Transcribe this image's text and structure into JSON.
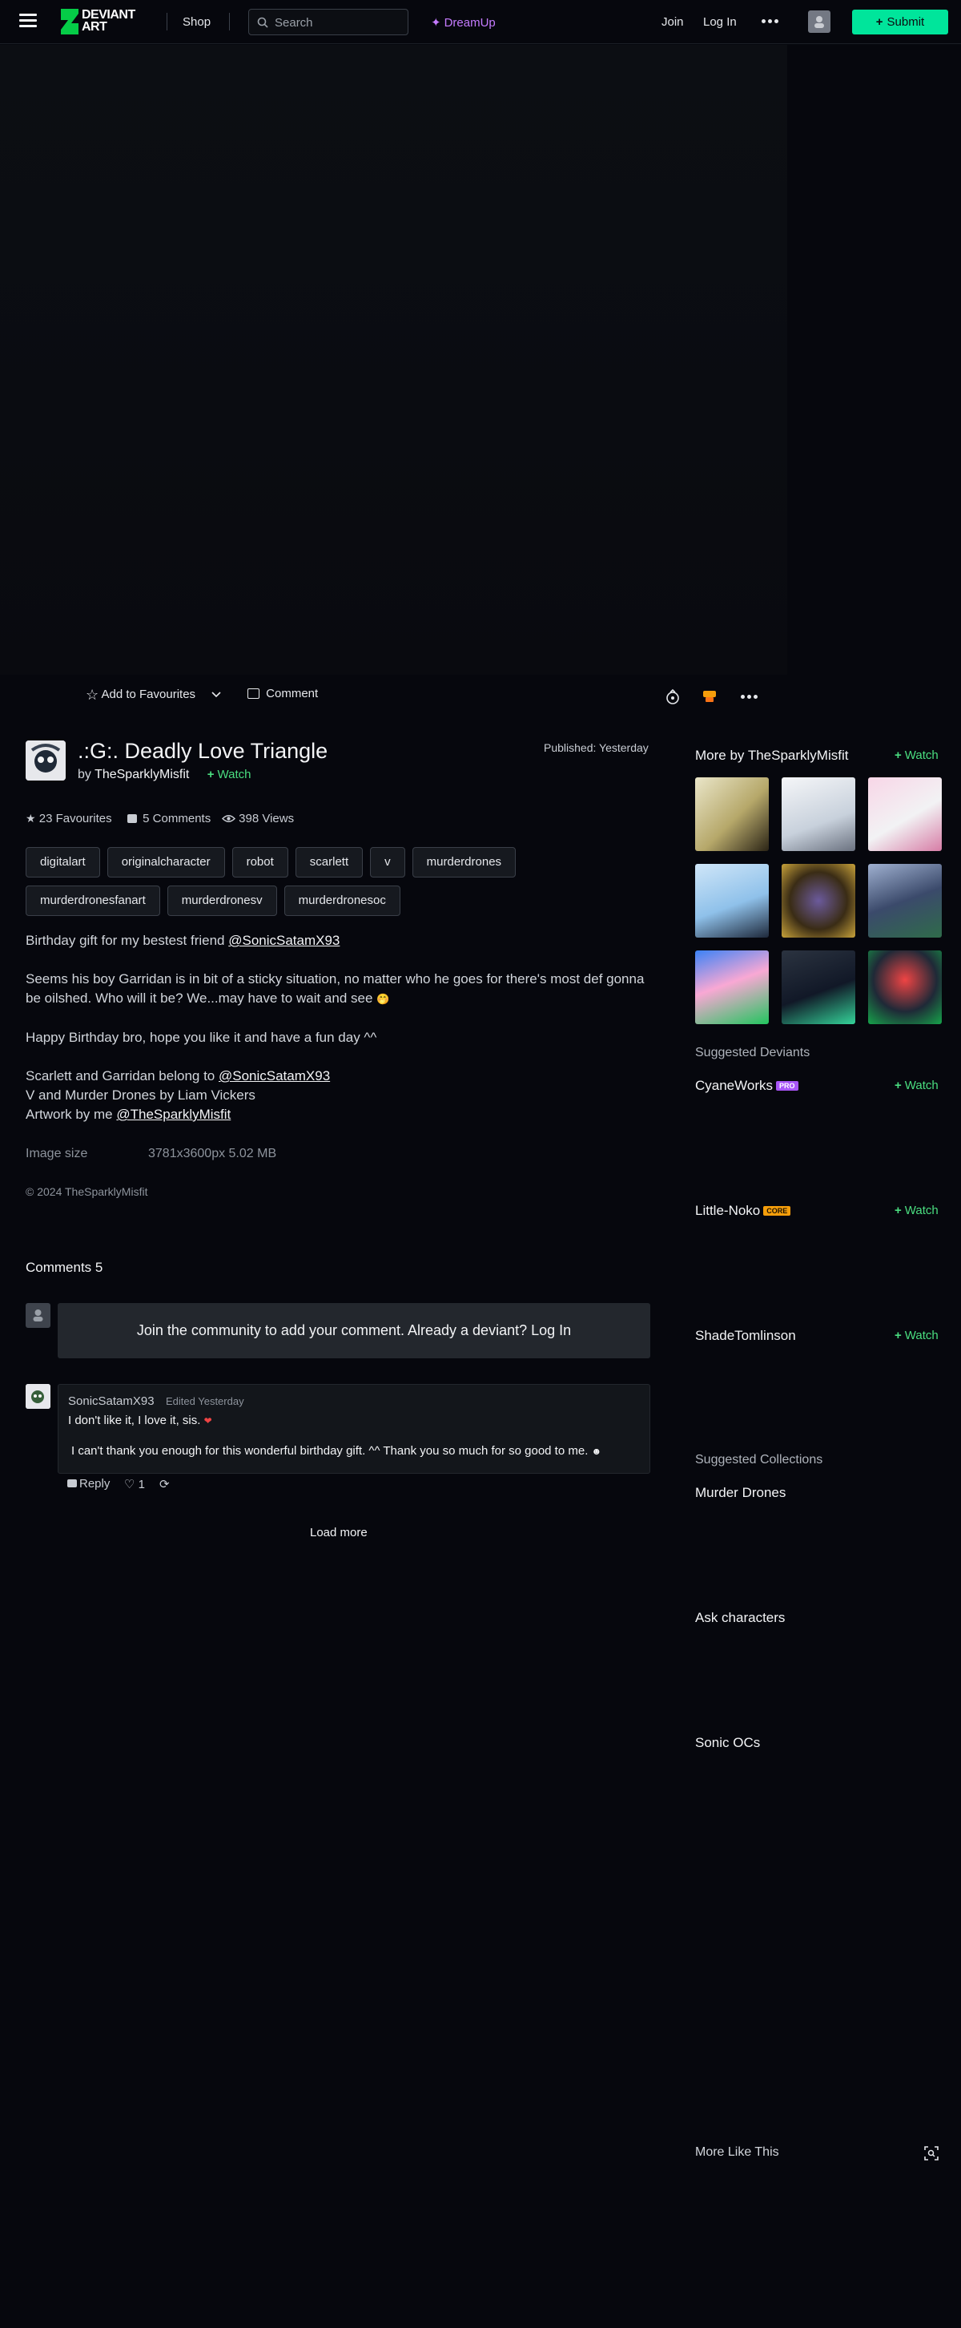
{
  "nav": {
    "logo_line1": "DEVIANT",
    "logo_line2": "ART",
    "shop": "Shop",
    "search_placeholder": "Search",
    "dreamup": "DreamUp",
    "join": "Join",
    "login": "Log In",
    "submit": "Submit",
    "accent": "#00e59b"
  },
  "actions": {
    "add_fav": "Add to Favourites",
    "comment": "Comment"
  },
  "deviation": {
    "title": ".:G:. Deadly Love Triangle",
    "by_prefix": "by",
    "author": "TheSparklyMisfit",
    "watch": "Watch",
    "published": "Published: Yesterday",
    "favourites": "23 Favourites",
    "comments": "5 Comments",
    "views": "398 Views",
    "tags": [
      "digitalart",
      "originalcharacter",
      "robot",
      "scarlett",
      "v",
      "murderdrones",
      "murderdronesfanart",
      "murderdronesv",
      "murderdronesoc"
    ],
    "desc1_text": "Birthday gift for my bestest friend ",
    "desc1_mention": "@SonicSatamX93",
    "desc2": "Seems his boy Garridan is in bit of a sticky situation, no matter who he goes for there's most def gonna be oilshed. Who will it be? We...may have to wait and see",
    "desc3": "Happy Birthday bro, hope you like it and have a fun day ^^",
    "desc4_text": "Scarlett and Garridan belong to ",
    "desc4_mention": "@SonicSatamX93",
    "desc5": "V and Murder Drones by Liam Vickers",
    "desc6_text": "Artwork by me ",
    "desc6_mention": "@TheSparklyMisfit",
    "image_size_label": "Image size",
    "image_size_value": "3781x3600px 5.02 MB",
    "copyright": "© 2024 TheSparklyMisfit"
  },
  "comments": {
    "header": "Comments 5",
    "join_prompt": "Join the community to add your comment. Already a deviant? Log In",
    "items": [
      {
        "user": "SonicSatamX93",
        "edited": "Edited Yesterday",
        "line1": "I don't like it, I love it, sis.",
        "line2": "I can't thank you enough for this wonderful birthday gift. ^^ Thank you so much for so good to me.",
        "reply": "Reply",
        "likes": "1"
      }
    ],
    "load_more": "Load more"
  },
  "sidebar": {
    "more_by": "More by TheSparklyMisfit",
    "watch": "Watch",
    "suggested_deviants": "Suggested Deviants",
    "deviants": [
      {
        "name": "CyaneWorks",
        "badge": "PRO",
        "badge_color": "#a855f7"
      },
      {
        "name": "Little-Noko",
        "badge": "CORE",
        "badge_color": "#f59e0b"
      },
      {
        "name": "ShadeTomlinson",
        "badge": "",
        "badge_color": ""
      }
    ],
    "suggested_collections": "Suggested Collections",
    "collections": [
      "Murder Drones",
      "Ask characters",
      "Sonic OCs"
    ],
    "more_like_this": "More Like This"
  }
}
